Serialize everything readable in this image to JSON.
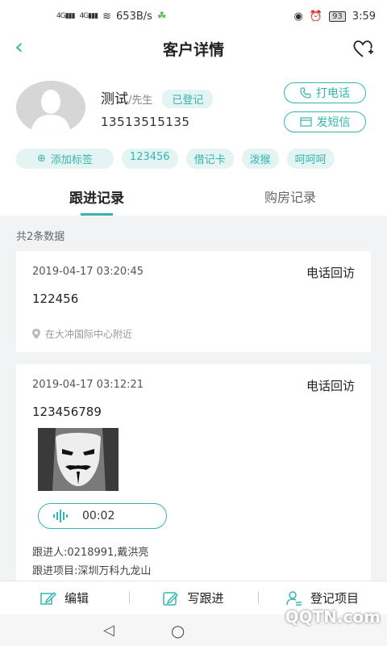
{
  "status_bar": {
    "signal1": "4G",
    "signal2": "4G",
    "speed": "653B/s",
    "battery": "93",
    "time": "3:59"
  },
  "header": {
    "title": "客户详情"
  },
  "customer": {
    "name": "测试",
    "title_suffix": "/先生",
    "status_badge": "已登记",
    "phone": "13513515135",
    "call_label": "打电话",
    "sms_label": "发短信"
  },
  "tags": {
    "add_label": "添加标签",
    "items": [
      "123456",
      "借记卡",
      "泼猴",
      "呵呵呵"
    ]
  },
  "tabs": [
    {
      "label": "跟进记录",
      "active": true
    },
    {
      "label": "购房记录",
      "active": false
    }
  ],
  "records": {
    "count_text": "共2条数据",
    "items": [
      {
        "datetime": "2019-04-17 03:20:45",
        "type": "电话回访",
        "content": "122456",
        "location": "在大冲国际中心附近"
      },
      {
        "datetime": "2019-04-17 03:12:21",
        "type": "电话回访",
        "content": "123456789",
        "audio_duration": "00:02",
        "follower": "跟进人:0218991,戴洪亮",
        "project": "跟进项目:深圳万科九龙山"
      }
    ]
  },
  "bottom_bar": {
    "edit": "编辑",
    "write_followup": "写跟进",
    "register_project": "登记项目"
  },
  "watermark": "QQTN.com",
  "colors": {
    "accent": "#36b5b0",
    "tag_bg": "#e3f4f2"
  }
}
